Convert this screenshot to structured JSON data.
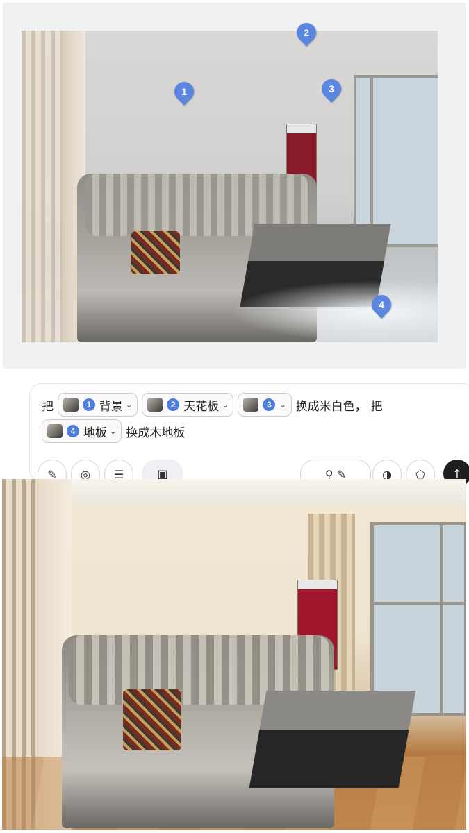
{
  "before_image": {
    "markers": [
      "1",
      "2",
      "3",
      "4"
    ]
  },
  "prompt": {
    "line1": {
      "word1": "把",
      "chips": [
        {
          "num": "1",
          "label": "背景"
        },
        {
          "num": "2",
          "label": "天花板"
        },
        {
          "num": "3",
          "label": ""
        }
      ],
      "word2": "换成米白色，",
      "word3": "把"
    },
    "line2": {
      "chip": {
        "num": "4",
        "label": "地板"
      },
      "word1": "换成木地板"
    }
  },
  "toolbar": {
    "icons": [
      "pen-icon",
      "at-icon",
      "list-icon",
      "image-icon",
      "search-icon",
      "pen-icon",
      "web-icon",
      "shape-icon",
      "send-icon"
    ]
  },
  "colors": {
    "marker": "#5a86e0",
    "chip_number": "#4d7fe0",
    "send_button": "#1f1f22"
  }
}
